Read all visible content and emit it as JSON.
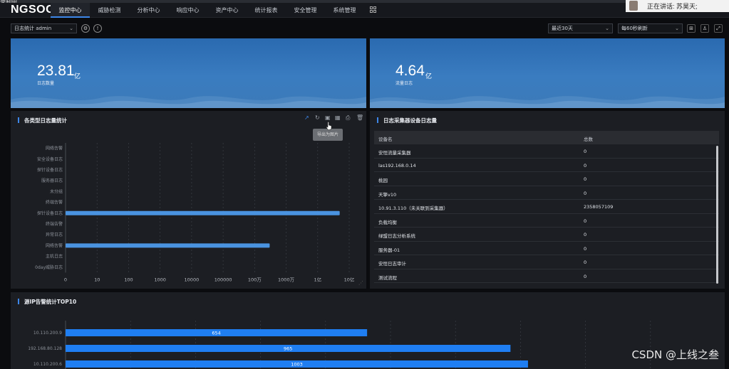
{
  "top_fragment": "录制中",
  "nav": {
    "logo": "NGSOC",
    "items": [
      "监控中心",
      "威胁检测",
      "分析中心",
      "响应中心",
      "资产中心",
      "统计报表",
      "安全管理",
      "系统管理"
    ]
  },
  "speaker": {
    "text": "正在讲话: 苏昊天;"
  },
  "toolbar": {
    "dashboard_select": "日志统计 admin",
    "time_range": "最近30天",
    "refresh": "每60秒刷新"
  },
  "cards": [
    {
      "value": "23.81",
      "unit": "亿",
      "label": "日志数量"
    },
    {
      "value": "4.64",
      "unit": "亿",
      "label": "流量日志"
    }
  ],
  "log_type_panel": {
    "title": "各类型日志量统计",
    "tooltip": "导出为图片"
  },
  "chart_data": [
    {
      "type": "bar",
      "orientation": "horizontal",
      "title": "各类型日志量统计",
      "categories": [
        "网络告警",
        "安全设备日志",
        "探针设备日志",
        "服务器日志",
        "未分组",
        "终端告警",
        "探针设备日志",
        "终端告警",
        "异常日志",
        "网络告警",
        "主机日志",
        "0day威胁日志"
      ],
      "x_ticks": [
        "0",
        "10",
        "100",
        "1000",
        "10000",
        "100000",
        "100万",
        "1000万",
        "1亿",
        "10亿"
      ],
      "scale": "log",
      "values": [
        0,
        0,
        0,
        0,
        0,
        0,
        500000000,
        0,
        0,
        3000000,
        0,
        0
      ],
      "grid": true
    },
    {
      "type": "bar",
      "orientation": "horizontal",
      "title": "源IP告警统计TOP10",
      "categories": [
        "10.110.200.9",
        "192.168.80.128",
        "10.110.200.6"
      ],
      "values": [
        654,
        965,
        1003
      ],
      "value_labels": [
        "654",
        "965",
        "1003"
      ]
    }
  ],
  "collector_panel": {
    "title": "日志采集器设备日志量",
    "columns": [
      "设备名",
      "总数"
    ],
    "rows": [
      [
        "安恒流量采集器",
        "0"
      ],
      [
        "las192.168.0.14",
        "0"
      ],
      [
        "桃园",
        "0"
      ],
      [
        "天擎v10",
        "0"
      ],
      [
        "10.91.3.110（未关联到采集器）",
        "2358057109"
      ],
      [
        "负载均衡",
        "0"
      ],
      [
        "绿盟日志分析系统",
        "0"
      ],
      [
        "服务器-01",
        "0"
      ],
      [
        "安恒日志审计",
        "0"
      ],
      [
        "测试流程",
        "0"
      ]
    ]
  },
  "top10_panel": {
    "title": "源IP告警统计TOP10"
  },
  "watermark": "CSDN @上线之叁",
  "colors": {
    "accent": "#3d86e8",
    "bar": "#4a93e0",
    "bar2": "#1f7ef2"
  }
}
